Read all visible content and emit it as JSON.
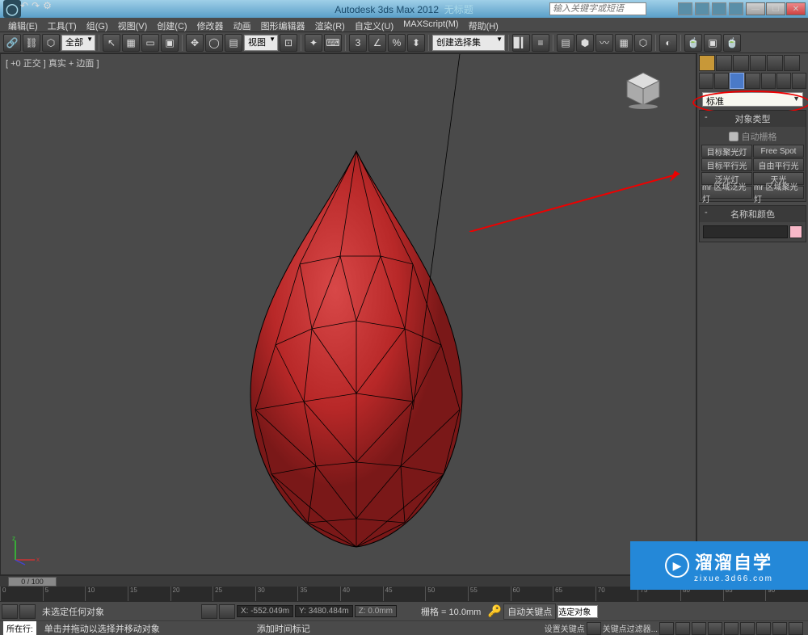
{
  "titlebar": {
    "app": "Autodesk 3ds Max 2012",
    "doc": "无标题",
    "search_placeholder": "输入关键字或短语"
  },
  "menu": [
    "编辑(E)",
    "工具(T)",
    "组(G)",
    "视图(V)",
    "创建(C)",
    "修改器",
    "动画",
    "图形编辑器",
    "渲染(R)",
    "自定义(U)",
    "MAXScript(M)",
    "帮助(H)"
  ],
  "toolbar": {
    "all_label": "全部",
    "view_label": "视图",
    "selset_label": "创建选择集"
  },
  "viewport": {
    "label": "[ +0 正交 ] 真实 + 边面 ]"
  },
  "panel": {
    "dropdown": "标准",
    "rollout1": "对象类型",
    "autogrid": "自动栅格",
    "lights": [
      [
        "目标聚光灯",
        "Free Spot"
      ],
      [
        "目标平行光",
        "自由平行光"
      ],
      [
        "泛光灯",
        "天光"
      ],
      [
        "mr 区域泛光灯",
        "mr 区域聚光灯"
      ]
    ],
    "rollout2": "名称和颜色"
  },
  "timeline": {
    "slider": "0 / 100",
    "ticks": [
      "0",
      "5",
      "10",
      "15",
      "20",
      "25",
      "30",
      "35",
      "40",
      "45",
      "50",
      "55",
      "60",
      "65",
      "70",
      "75",
      "80",
      "85",
      "90"
    ]
  },
  "status": {
    "nosel": "未选定任何对象",
    "x": "X: -552.049m",
    "y": "Y: 3480.484m",
    "z": "Z: 0.0mm",
    "grid": "栅格 = 10.0mm",
    "autokey": "自动关键点",
    "selset": "选定对象",
    "nowrow": "所在行:",
    "hint": "单击并拖动以选择并移动对象",
    "timetag": "添加时间标记",
    "setkey": "设置关键点",
    "keyfilter": "关键点过滤器..."
  },
  "watermark": {
    "big": "溜溜自学",
    "url": "zixue.3d66.com"
  }
}
